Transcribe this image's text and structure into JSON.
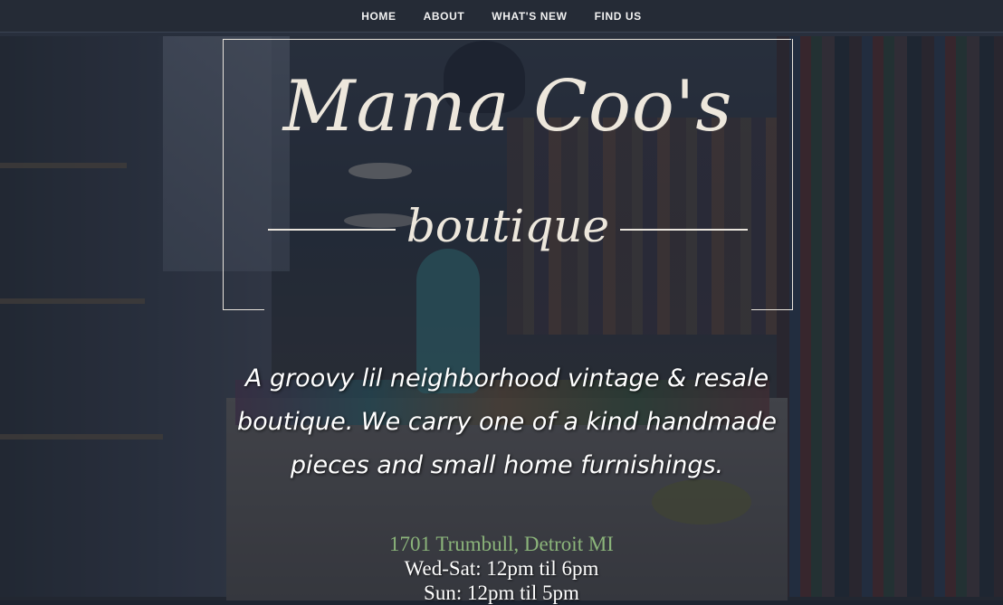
{
  "nav": {
    "items": [
      {
        "label": "HOME"
      },
      {
        "label": "ABOUT"
      },
      {
        "label": "WHAT'S NEW"
      },
      {
        "label": "FIND US"
      }
    ]
  },
  "logo": {
    "name": "Mama Coo's",
    "subtitle": "boutique"
  },
  "tagline": "A groovy lil neighborhood vintage & resale boutique. We carry one of a kind handmade pieces and small home furnishings.",
  "location": {
    "address": "1701 Trumbull, Detroit MI",
    "hours": [
      "Wed-Sat: 12pm til 6pm",
      "Sun: 12pm til 5pm"
    ]
  },
  "colors": {
    "nav_bg": "#252b36",
    "address_green": "#8bb47a",
    "text_light": "#ede7dc"
  }
}
